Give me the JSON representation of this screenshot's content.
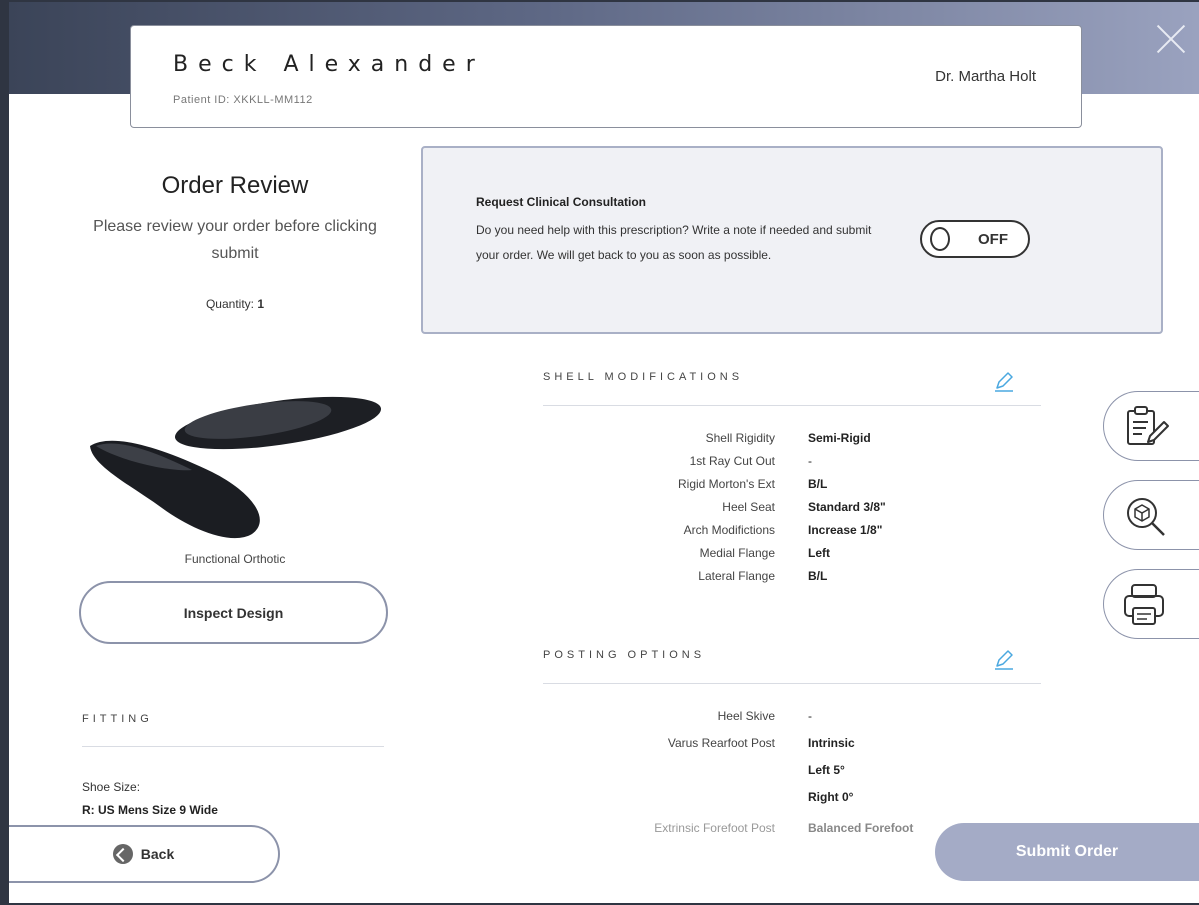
{
  "header": {
    "patient_name": "Beck Alexander",
    "patient_id": "Patient ID: XKKLL-MM112",
    "doctor": "Dr. Martha Holt"
  },
  "review": {
    "title": "Order Review",
    "subtitle": "Please review your order before clicking submit",
    "quantity_label": "Quantity:",
    "quantity_value": "1"
  },
  "consultation": {
    "title": "Request Clinical Consultation",
    "text": "Do you need help with this prescription? Write a note if needed and submit your order. We will get back to you as soon as possible.",
    "toggle_label": "OFF",
    "toggle_on": false
  },
  "product": {
    "label": "Functional Orthotic",
    "inspect_label": "Inspect Design"
  },
  "shell": {
    "heading": "SHELL MODIFICATIONS",
    "rows": [
      {
        "label": "Shell Rigidity",
        "value": "Semi-Rigid"
      },
      {
        "label": "1st Ray Cut Out",
        "value": "-"
      },
      {
        "label": "Rigid Morton's Ext",
        "value": "B/L"
      },
      {
        "label": "Heel Seat",
        "value": "Standard 3/8\""
      },
      {
        "label": "Arch Modifictions",
        "value": "Increase 1/8\""
      },
      {
        "label": "Medial Flange",
        "value": "Left"
      },
      {
        "label": "Lateral Flange",
        "value": "B/L"
      }
    ]
  },
  "posting": {
    "heading": "POSTING OPTIONS",
    "rows": [
      {
        "label": "Heel Skive",
        "value": "-"
      },
      {
        "label": "Varus Rearfoot Post",
        "value": "Intrinsic"
      },
      {
        "label": "",
        "value": "Left 5°"
      },
      {
        "label": "",
        "value": "Right 0°"
      },
      {
        "label": "Extrinsic Forefoot Post",
        "value": "Balanced Forefoot"
      }
    ]
  },
  "fitting": {
    "heading": "FITTING",
    "shoe_size_label": "Shoe Size:",
    "shoe_size_value": "R: US Mens Size 9 Wide"
  },
  "actions": {
    "back_label": "Back",
    "submit_label": "Submit Order"
  },
  "side_tools": [
    {
      "icon": "clipboard-edit-icon"
    },
    {
      "icon": "3d-inspect-icon"
    },
    {
      "icon": "printer-icon"
    }
  ],
  "colors": {
    "accent_blue": "#4aa8e0",
    "button_border": "#8c93aa",
    "submit_bg": "#a4abc6"
  }
}
